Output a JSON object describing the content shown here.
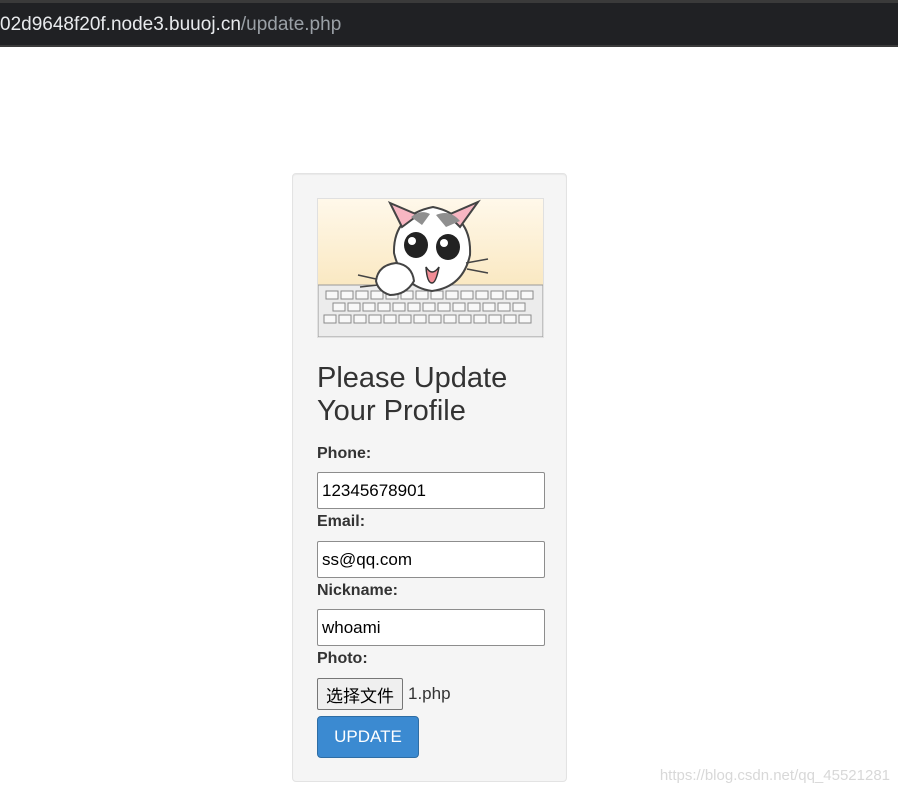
{
  "browser": {
    "url_host": "02d9648f20f.node3.buuoj.cn",
    "url_path": "/update.php"
  },
  "form": {
    "title": "Please Update Your Profile",
    "phone_label": "Phone:",
    "phone_value": "12345678901",
    "email_label": "Email:",
    "email_value": "ss@qq.com",
    "nickname_label": "Nickname:",
    "nickname_value": "whoami",
    "photo_label": "Photo:",
    "file_button": "选择文件",
    "file_name": "1.php",
    "submit": "UPDATE"
  },
  "watermark": "https://blog.csdn.net/qq_45521281",
  "colors": {
    "url_bar": "#202124",
    "card_bg": "#f5f5f5",
    "button": "#3b8ad1"
  },
  "icons": {
    "hero_image": "cartoon-cat-keyboard-image"
  }
}
